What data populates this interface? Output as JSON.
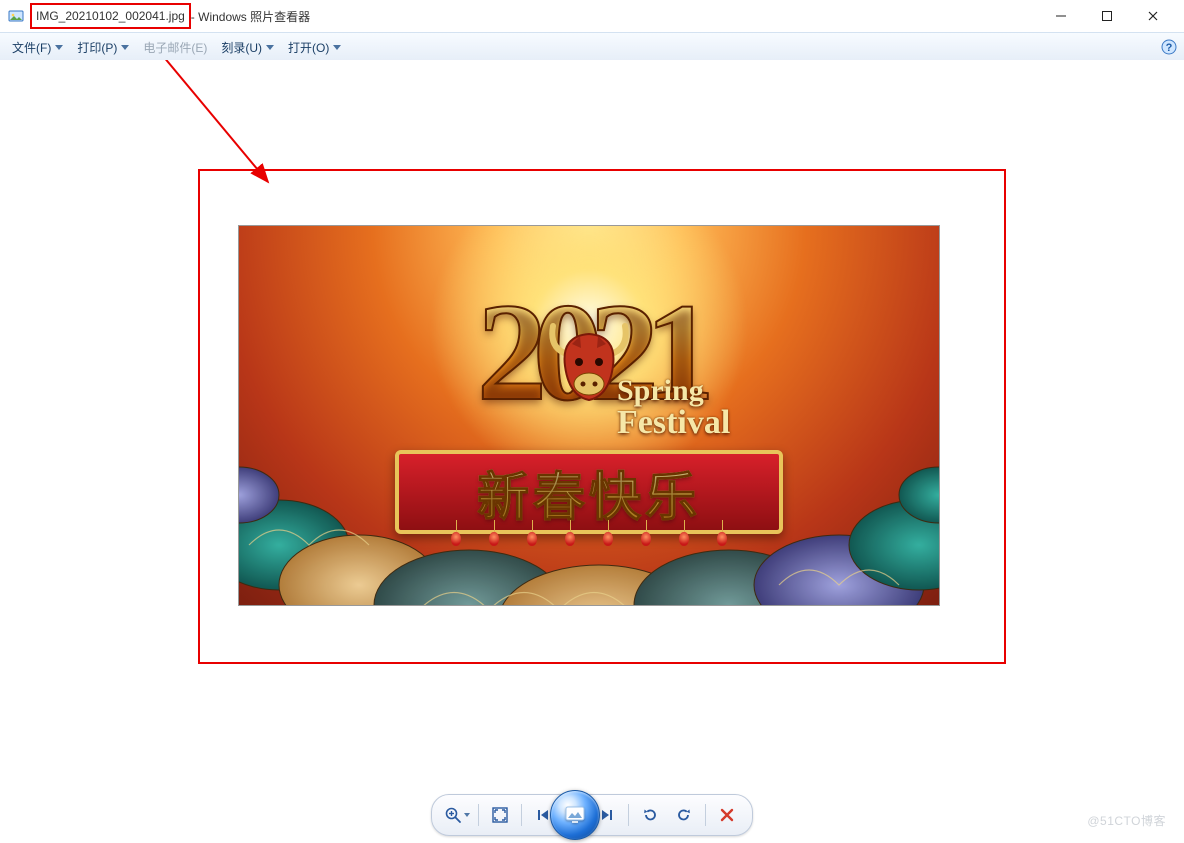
{
  "window": {
    "filename": "IMG_20210102_002041.jpg",
    "title_suffix": " - Windows 照片查看器"
  },
  "menu": {
    "file": "文件(F)",
    "print": "打印(P)",
    "email": "电子邮件(E)",
    "burn": "刻录(U)",
    "open": "打开(O)"
  },
  "toolbar_icons": {
    "zoom": "zoom-icon",
    "fit": "fit-window-icon",
    "prev": "previous-icon",
    "slideshow": "slideshow-icon",
    "next": "next-icon",
    "rotate_ccw": "rotate-ccw-icon",
    "rotate_cw": "rotate-cw-icon",
    "delete": "delete-icon"
  },
  "artwork": {
    "year": "2021",
    "spring_line1": "Spring",
    "spring_line2": "Festival",
    "banner_text": "新春快乐"
  },
  "watermark": "@51CTO博客",
  "colors": {
    "annotation_red": "#e80000",
    "menu_blue": "#1b3f66",
    "tb_blue": "#2a5aa0",
    "delete_red": "#d43a2b"
  }
}
